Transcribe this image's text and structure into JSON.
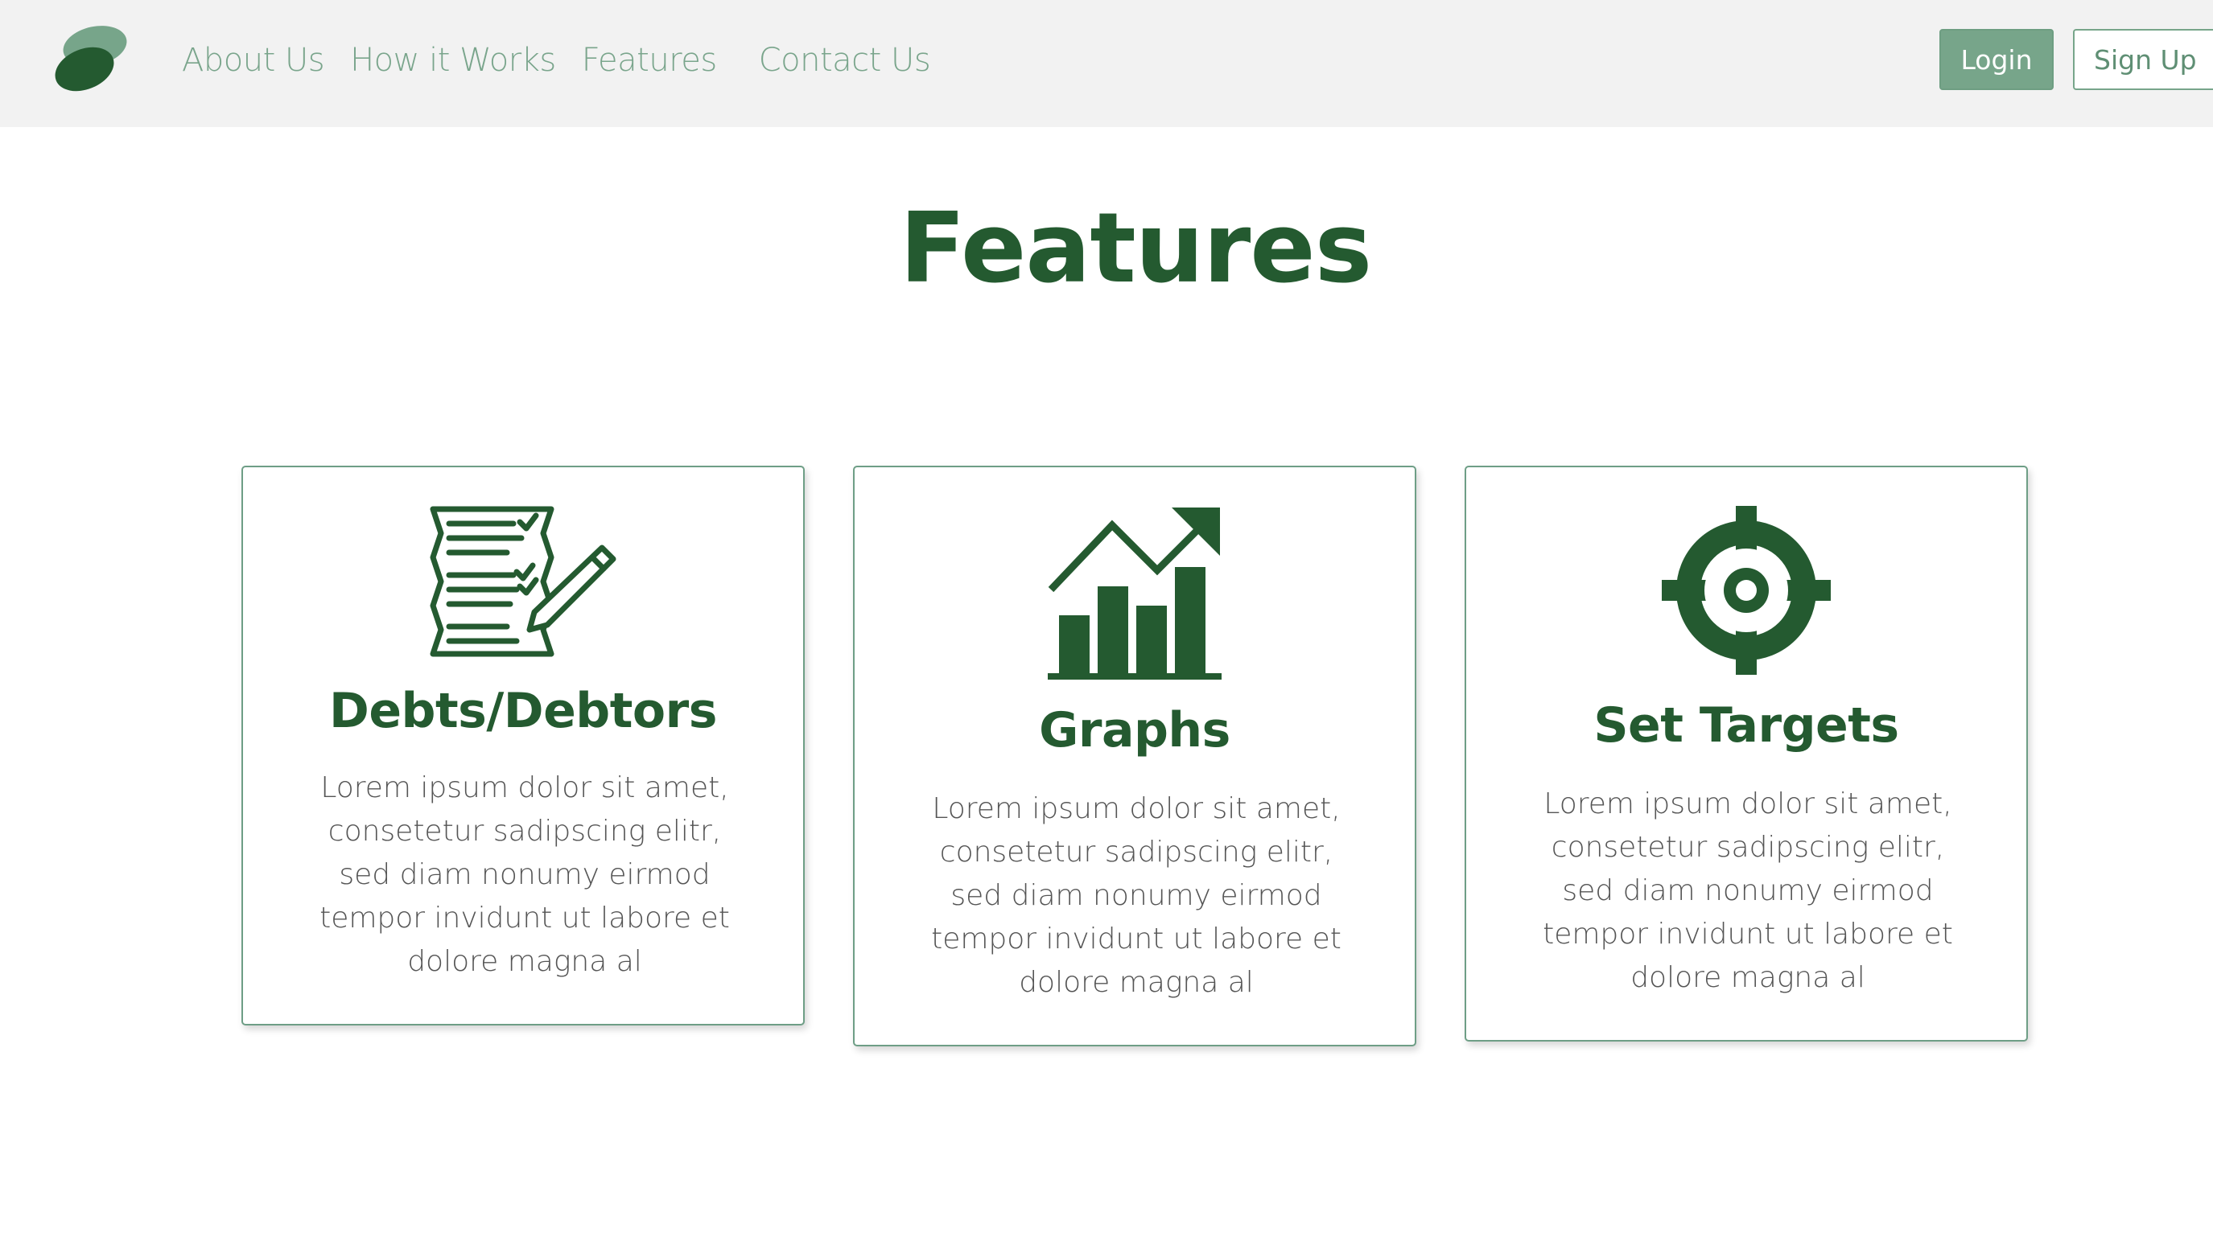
{
  "nav": {
    "links": [
      "About Us",
      "How it Works",
      "Features",
      "Contact Us"
    ],
    "login_label": "Login",
    "signup_label": "Sign Up"
  },
  "page": {
    "title": "Features"
  },
  "cards": [
    {
      "icon": "checklist-pencil-icon",
      "title": "Debts/Debtors",
      "text": "Lorem ipsum dolor sit amet, consetetur sadipscing elitr, sed diam nonumy eirmod tempor invidunt ut labore et dolore magna al"
    },
    {
      "icon": "growth-chart-icon",
      "title": "Graphs",
      "text": "Lorem ipsum dolor sit amet, consetetur sadipscing elitr, sed diam nonumy eirmod tempor invidunt ut labore et dolore magna al"
    },
    {
      "icon": "target-crosshair-icon",
      "title": "Set Targets",
      "text": "Lorem ipsum dolor sit amet, consetetur sadipscing elitr, sed diam nonumy eirmod tempor invidunt ut labore et dolore magna al"
    }
  ],
  "colors": {
    "brand_dark": "#245a30",
    "brand_light": "#77a58a",
    "nav_background": "#f2f2f2"
  }
}
